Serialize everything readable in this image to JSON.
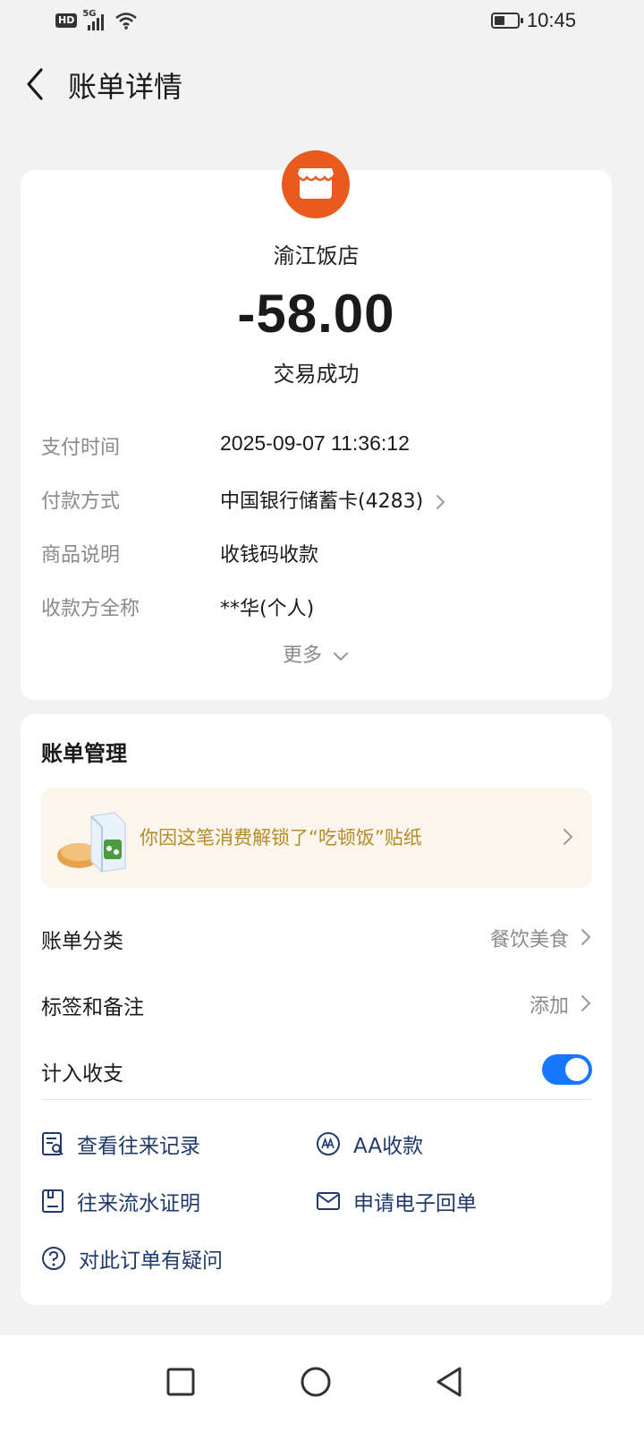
{
  "status_bar": {
    "hd": "HD",
    "network": "5G",
    "battery_level": 0.45,
    "time": "10:45"
  },
  "header": {
    "title": "账单详情",
    "back_icon": "chevron-left-icon"
  },
  "transaction": {
    "merchant_icon": "shop-icon",
    "merchant_color": "#e95a1f",
    "merchant_name": "渝江饭店",
    "amount": "-58.00",
    "status": "交易成功",
    "details": [
      {
        "label": "支付时间",
        "value": "2025-09-07 11:36:12"
      },
      {
        "label": "付款方式",
        "value": "中国银行储蓄卡(4283)"
      },
      {
        "label": "商品说明",
        "value": "收钱码收款"
      },
      {
        "label": "收款方全称",
        "value": "**华(个人)"
      }
    ],
    "more_label": "更多"
  },
  "management": {
    "title": "账单管理",
    "sticker_banner": "你因这笔消费解锁了“吃顿饭”贴纸",
    "category": {
      "label": "账单分类",
      "value": "餐饮美食"
    },
    "tags": {
      "label": "标签和备注",
      "value": "添加"
    },
    "include": {
      "label": "计入收支",
      "enabled": true
    },
    "actions": [
      {
        "label": "查看往来记录",
        "icon": "records-icon"
      },
      {
        "label": "AA收款",
        "icon": "aa-icon"
      },
      {
        "label": "往来流水证明",
        "icon": "statement-icon"
      },
      {
        "label": "申请电子回单",
        "icon": "mail-icon"
      },
      {
        "label": "对此订单有疑问",
        "icon": "question-icon"
      }
    ]
  },
  "colors": {
    "accent": "#1677ff",
    "link_text": "#1f3a6b",
    "sticker_text": "#b58a2a",
    "sticker_bg": "#faf6ee"
  },
  "navigation": {
    "recents_icon": "square-icon",
    "home_icon": "circle-icon",
    "back_icon": "triangle-back-icon"
  }
}
